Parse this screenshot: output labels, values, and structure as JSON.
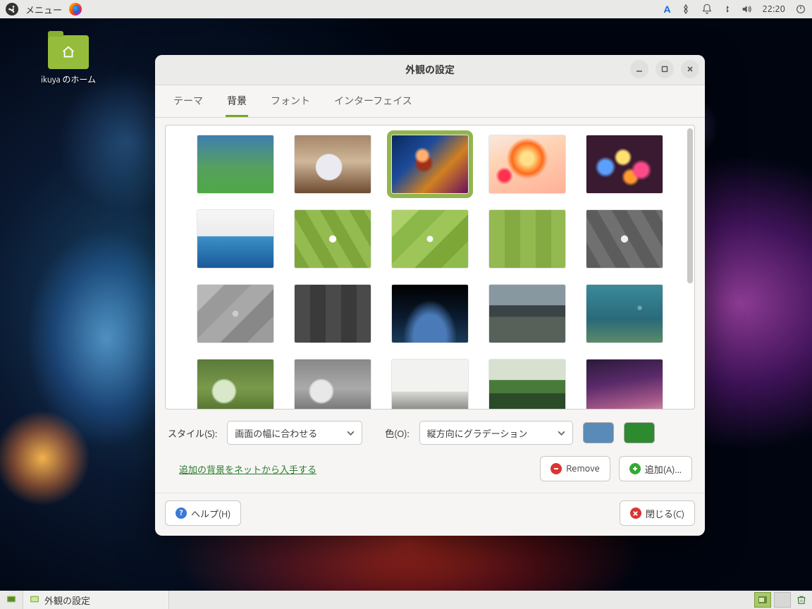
{
  "panel": {
    "menu_label": "メニュー",
    "input_indicator": "A",
    "clock": "22:20"
  },
  "desktop": {
    "home_label": "ikuya のホーム"
  },
  "window": {
    "title": "外観の設定",
    "tabs": [
      "テーマ",
      "背景",
      "フォント",
      "インターフェイス"
    ],
    "active_tab": 1,
    "style_label": "スタイル(S):",
    "style_value": "画面の幅に合わせる",
    "color_label": "色(O):",
    "color_value": "縦方向にグラデーション",
    "primary_color": "#5a8ab8",
    "secondary_color": "#2e8a2e",
    "online_link": "追加の背景をネットから入手する",
    "remove_label": "Remove",
    "add_label": "追加(A)...",
    "help_label": "ヘルプ(H)",
    "close_label": "閉じる(C)"
  },
  "taskbar": {
    "task1": "外観の設定"
  }
}
